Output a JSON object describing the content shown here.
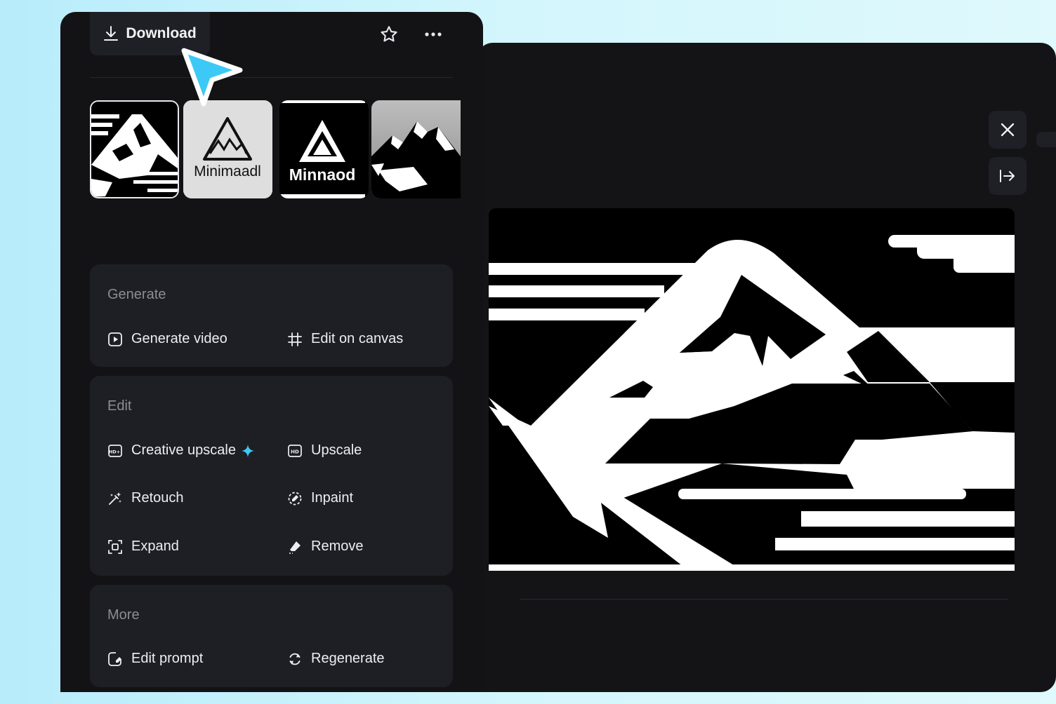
{
  "toolbar": {
    "download_label": "Download",
    "star_icon": "star-icon",
    "more_icon": "more-horizontal-icon"
  },
  "thumbnails": [
    {
      "label": "",
      "style": "mountain-lines"
    },
    {
      "label": "Minimaadl",
      "style": "logo-light"
    },
    {
      "label": "Minnaod",
      "style": "logo-dark"
    },
    {
      "label": "",
      "style": "mountain-gray"
    }
  ],
  "sections": {
    "generate": {
      "title": "Generate",
      "items": [
        {
          "label": "Generate video",
          "icon": "play-square-icon"
        },
        {
          "label": "Edit on canvas",
          "icon": "crop-frame-icon"
        }
      ]
    },
    "edit": {
      "title": "Edit",
      "items": [
        {
          "label": "Creative upscale",
          "icon": "hd-plus-icon",
          "badge_icon": "sparkle-icon"
        },
        {
          "label": "Upscale",
          "icon": "hd-icon"
        },
        {
          "label": "Retouch",
          "icon": "magic-wand-icon"
        },
        {
          "label": "Inpaint",
          "icon": "dashed-circle-brush-icon"
        },
        {
          "label": "Expand",
          "icon": "expand-frame-icon"
        },
        {
          "label": "Remove",
          "icon": "eraser-icon"
        }
      ]
    },
    "more": {
      "title": "More",
      "items": [
        {
          "label": "Edit prompt",
          "icon": "edit-square-icon"
        },
        {
          "label": "Regenerate",
          "icon": "refresh-icon"
        }
      ]
    }
  },
  "viewer": {
    "close_icon": "close-icon",
    "expand_icon": "collapse-right-icon"
  },
  "colors": {
    "accent": "#3dc9f5",
    "panel_bg": "#131316",
    "card_bg": "#1e1f25"
  }
}
